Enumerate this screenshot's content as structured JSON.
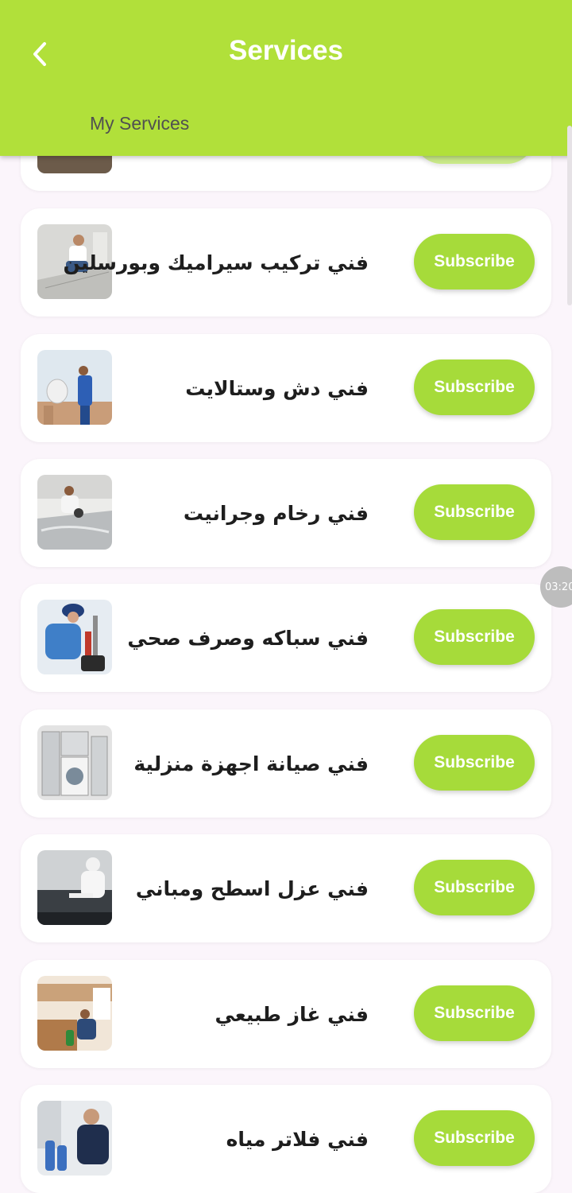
{
  "header": {
    "title": "Services",
    "tab_label": "My Services"
  },
  "services": [
    {
      "name": "فني تركيب سيراميك وبورسلين",
      "button": "Subscribe",
      "icon": "tile-worker-image"
    },
    {
      "name": "فني دش وستالايت",
      "button": "Subscribe",
      "icon": "satellite-technician-image"
    },
    {
      "name": "فني رخام وجرانيت",
      "button": "Subscribe",
      "icon": "marble-worker-image"
    },
    {
      "name": "فني سباكه وصرف صحي",
      "button": "Subscribe",
      "icon": "plumber-image"
    },
    {
      "name": "فني صيانة اجهزة منزلية",
      "button": "Subscribe",
      "icon": "appliances-image"
    },
    {
      "name": "فني عزل اسطح ومباني",
      "button": "Subscribe",
      "icon": "roof-insulation-image"
    },
    {
      "name": "فني غاز طبيعي",
      "button": "Subscribe",
      "icon": "gas-technician-image"
    },
    {
      "name": "فني فلاتر مياه",
      "button": "Subscribe",
      "icon": "water-filter-image"
    }
  ],
  "timer_badge": "03:20",
  "colors": {
    "accent": "#b1e03a",
    "button": "#a6db3a",
    "background": "#fbf5fb"
  }
}
